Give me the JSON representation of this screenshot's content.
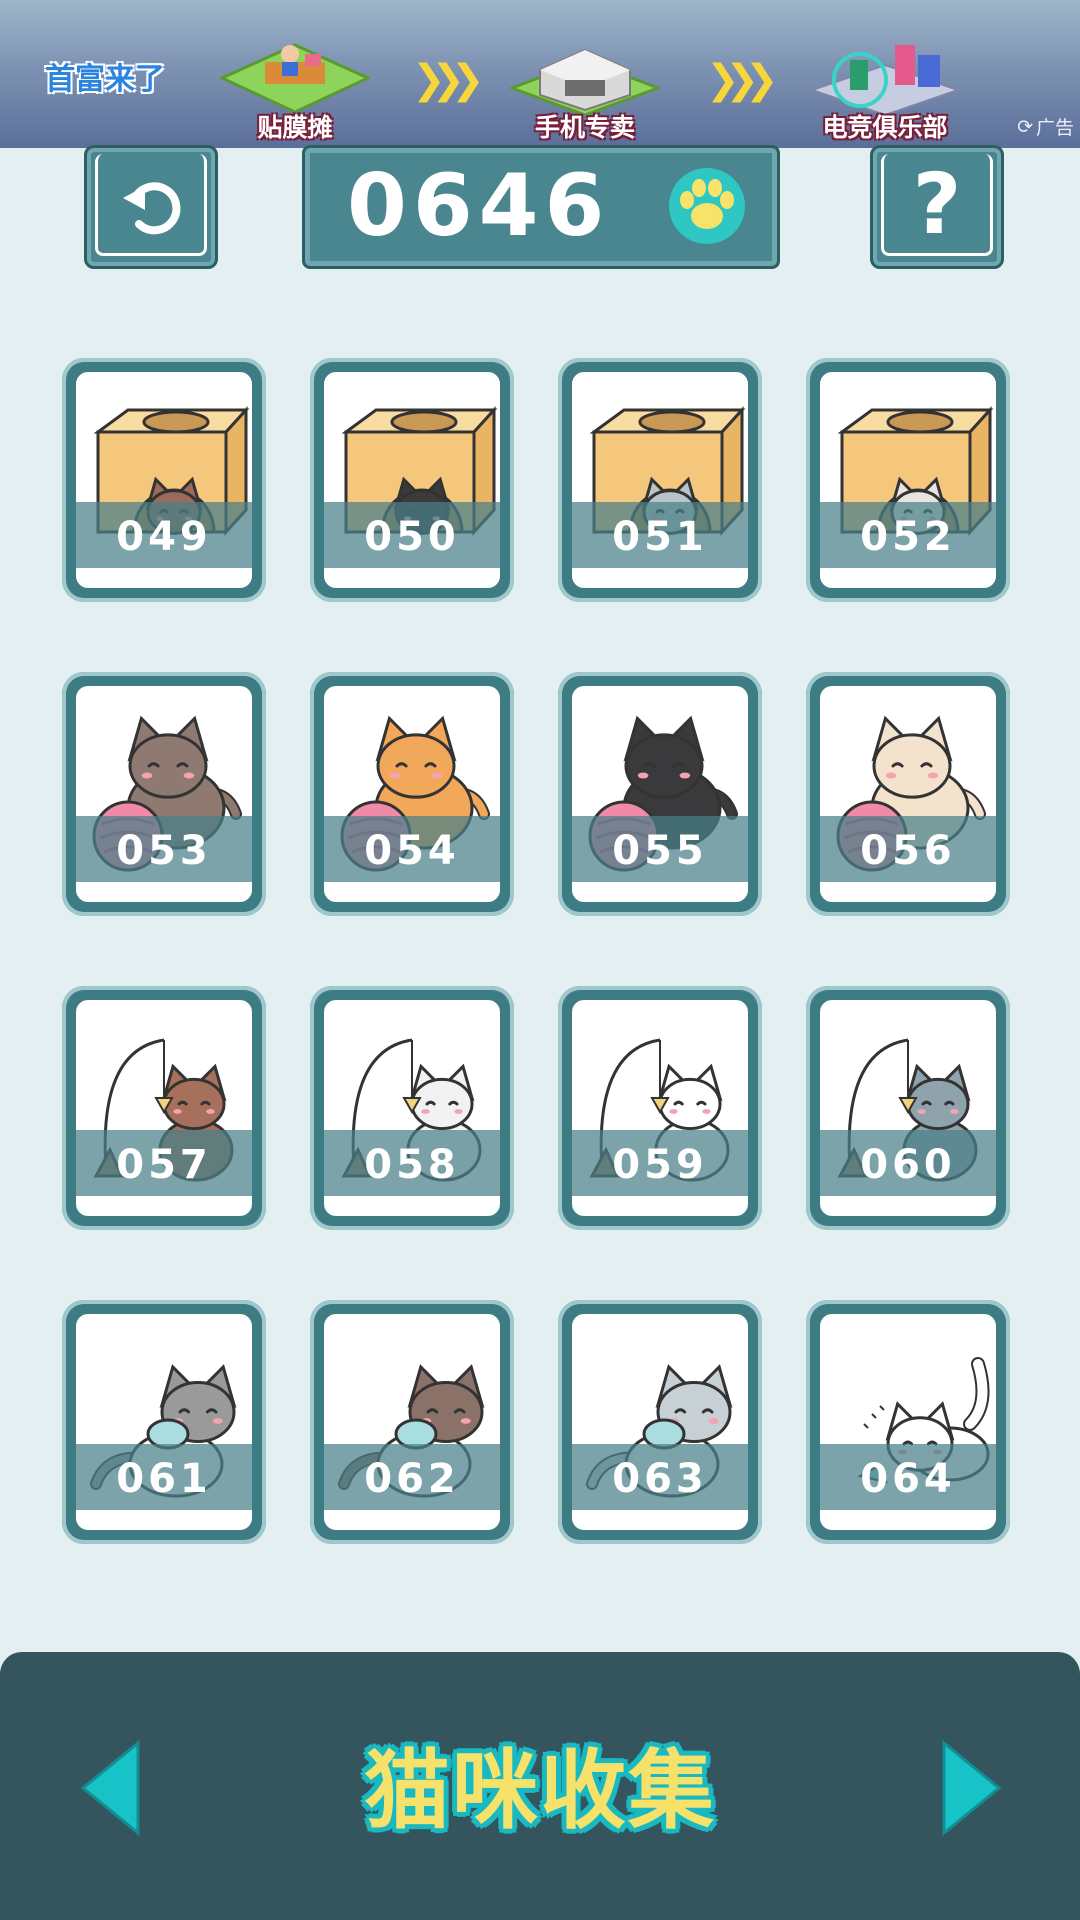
{
  "ad": {
    "logo_text": "首富来了",
    "stages": [
      {
        "label": "贴膜摊",
        "icon": "sticker-stall-icon"
      },
      {
        "label": "手机专卖",
        "icon": "phone-store-icon"
      },
      {
        "label": "电竞俱乐部",
        "icon": "esports-club-icon"
      }
    ],
    "arrow_glyph": "❯❯❯",
    "tag": "广告"
  },
  "header": {
    "back_icon": "undo-icon",
    "coin_count": "0646",
    "currency_icon": "paw-icon",
    "help_label": "?"
  },
  "cards": [
    {
      "number": "049",
      "scene": "cat-in-box",
      "cat_color": "#9a6b5b"
    },
    {
      "number": "050",
      "scene": "cat-in-box",
      "cat_color": "#3b3b3b"
    },
    {
      "number": "051",
      "scene": "cat-in-box",
      "cat_color": "#b9c4c7"
    },
    {
      "number": "052",
      "scene": "cat-in-box",
      "cat_color": "#e9e4df"
    },
    {
      "number": "053",
      "scene": "cat-with-yarn",
      "cat_color": "#8f7a72"
    },
    {
      "number": "054",
      "scene": "cat-with-yarn",
      "cat_color": "#f2a85a"
    },
    {
      "number": "055",
      "scene": "cat-with-yarn",
      "cat_color": "#3a3a3d"
    },
    {
      "number": "056",
      "scene": "cat-with-yarn",
      "cat_color": "#f3e2cc"
    },
    {
      "number": "057",
      "scene": "cat-with-teaser",
      "cat_color": "#a6705c"
    },
    {
      "number": "058",
      "scene": "cat-with-teaser",
      "cat_color": "#f2f2f2"
    },
    {
      "number": "059",
      "scene": "cat-with-teaser",
      "cat_color": "#ffffff"
    },
    {
      "number": "060",
      "scene": "cat-with-teaser",
      "cat_color": "#8fa3ad"
    },
    {
      "number": "061",
      "scene": "cat-with-toy",
      "cat_color": "#9a9a9a"
    },
    {
      "number": "062",
      "scene": "cat-with-toy",
      "cat_color": "#8a7269"
    },
    {
      "number": "063",
      "scene": "cat-with-toy",
      "cat_color": "#c7d0d4"
    },
    {
      "number": "064",
      "scene": "cat-playing",
      "cat_color": "#ffffff"
    }
  ],
  "bottom": {
    "title": "猫咪收集",
    "prev_icon": "triangle-left-icon",
    "next_icon": "triangle-right-icon",
    "accent_color": "#19b9c2"
  }
}
